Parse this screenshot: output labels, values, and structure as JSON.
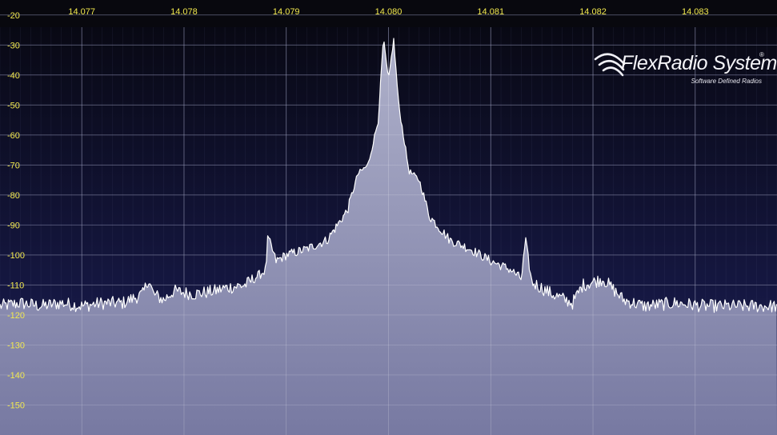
{
  "chart_data": {
    "type": "area",
    "x_unit": "MHz",
    "y_unit": "dB",
    "xlim": [
      14.0762,
      14.0838
    ],
    "ylim": [
      -160,
      -15
    ],
    "frequency_ticks": [
      "14.077",
      "14.078",
      "14.079",
      "14.080",
      "14.081",
      "14.082",
      "14.083"
    ],
    "db_ticks": [
      "-20",
      "-30",
      "-40",
      "-50",
      "-60",
      "-70",
      "-80",
      "-90",
      "-100",
      "-110",
      "-120",
      "-130",
      "-140",
      "-150"
    ],
    "grid": true,
    "noise_floor": -117,
    "spectrum": [
      {
        "f": 14.0762,
        "db": -117
      },
      {
        "f": 14.0764,
        "db": -116
      },
      {
        "f": 14.0766,
        "db": -117
      },
      {
        "f": 14.0768,
        "db": -116
      },
      {
        "f": 14.077,
        "db": -117
      },
      {
        "f": 14.0772,
        "db": -116
      },
      {
        "f": 14.0774,
        "db": -116
      },
      {
        "f": 14.0776,
        "db": -113
      },
      {
        "f": 14.07765,
        "db": -108
      },
      {
        "f": 14.0777,
        "db": -113
      },
      {
        "f": 14.0778,
        "db": -115
      },
      {
        "f": 14.0779,
        "db": -112
      },
      {
        "f": 14.0781,
        "db": -113
      },
      {
        "f": 14.0783,
        "db": -112
      },
      {
        "f": 14.0784,
        "db": -111
      },
      {
        "f": 14.0786,
        "db": -110
      },
      {
        "f": 14.0788,
        "db": -105
      },
      {
        "f": 14.07882,
        "db": -94
      },
      {
        "f": 14.0789,
        "db": -102
      },
      {
        "f": 14.079,
        "db": -100
      },
      {
        "f": 14.0792,
        "db": -98
      },
      {
        "f": 14.0794,
        "db": -95
      },
      {
        "f": 14.0796,
        "db": -85
      },
      {
        "f": 14.0797,
        "db": -73
      },
      {
        "f": 14.0798,
        "db": -70
      },
      {
        "f": 14.0799,
        "db": -55
      },
      {
        "f": 14.07995,
        "db": -28
      },
      {
        "f": 14.08,
        "db": -42
      },
      {
        "f": 14.08005,
        "db": -28
      },
      {
        "f": 14.0801,
        "db": -50
      },
      {
        "f": 14.0802,
        "db": -72
      },
      {
        "f": 14.0803,
        "db": -75
      },
      {
        "f": 14.0804,
        "db": -87
      },
      {
        "f": 14.0806,
        "db": -95
      },
      {
        "f": 14.0808,
        "db": -98
      },
      {
        "f": 14.081,
        "db": -102
      },
      {
        "f": 14.0812,
        "db": -105
      },
      {
        "f": 14.0813,
        "db": -108
      },
      {
        "f": 14.08134,
        "db": -95
      },
      {
        "f": 14.0814,
        "db": -109
      },
      {
        "f": 14.0816,
        "db": -113
      },
      {
        "f": 14.0818,
        "db": -116
      },
      {
        "f": 14.0819,
        "db": -110
      },
      {
        "f": 14.0821,
        "db": -108
      },
      {
        "f": 14.0823,
        "db": -115
      },
      {
        "f": 14.0825,
        "db": -117
      },
      {
        "f": 14.0828,
        "db": -116
      },
      {
        "f": 14.0831,
        "db": -117
      },
      {
        "f": 14.0834,
        "db": -117
      },
      {
        "f": 14.0838,
        "db": -117
      }
    ]
  },
  "logo": {
    "text": "FlexRadio Systems",
    "registered": "®",
    "tagline": "Software Defined Radios"
  },
  "colors": {
    "background_top": "#07070f",
    "background_bottom": "#1c1f5a",
    "fill_top": "#b4b6d0",
    "fill_bottom": "#7a7ca4",
    "trace": "#ffffff",
    "grid": "#5a5e86",
    "label": "#f2e94e"
  }
}
